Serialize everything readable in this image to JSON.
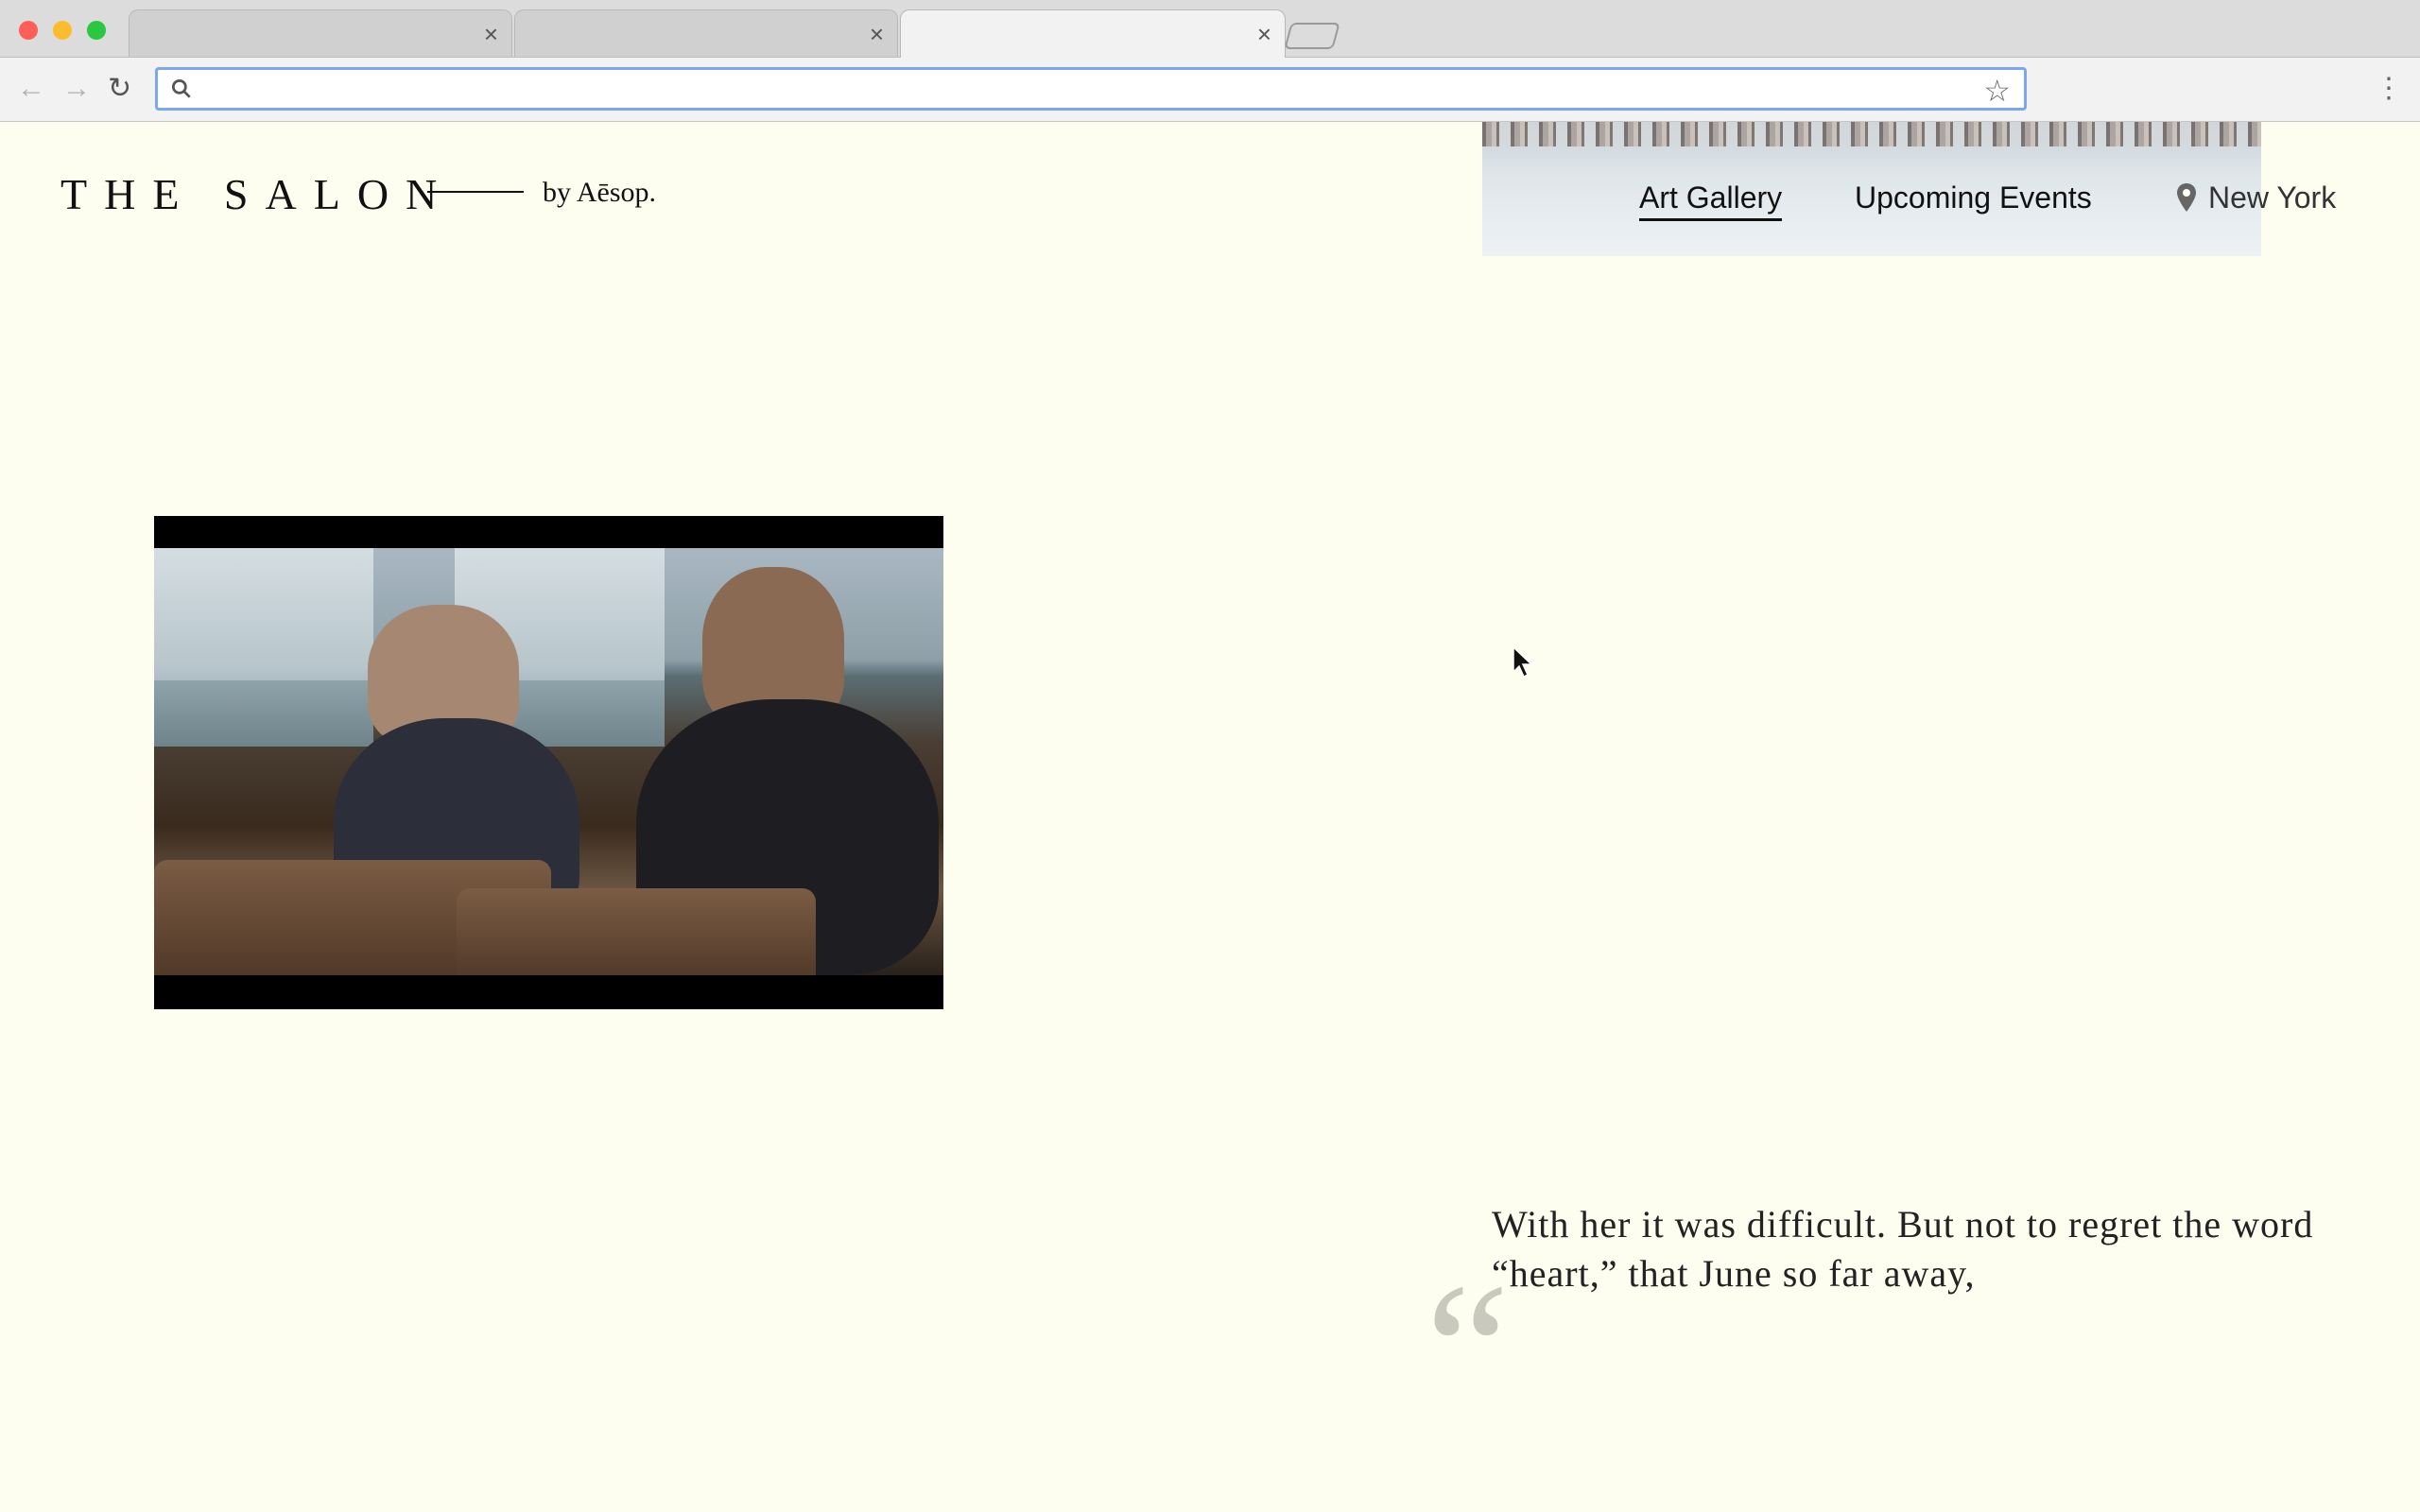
{
  "browser": {
    "tabs": [
      {
        "title": "",
        "close": "×"
      },
      {
        "title": "",
        "close": "×"
      },
      {
        "title": "",
        "close": "×"
      }
    ],
    "address": {
      "value": "",
      "placeholder": ""
    },
    "icons": {
      "back": "←",
      "forward": "→",
      "reload": "↻",
      "bookmark": "☆",
      "menu": "⋮"
    }
  },
  "site": {
    "logo": "THE SALON",
    "byline": "by Aēsop.",
    "nav": [
      {
        "label": "Art Gallery",
        "active": true
      },
      {
        "label": "Upcoming Events",
        "active": false
      }
    ],
    "location": "New York"
  },
  "quote": {
    "mark": "“",
    "text": "With her it was difficult. But not to regret the word “heart,” that June so far away,"
  }
}
